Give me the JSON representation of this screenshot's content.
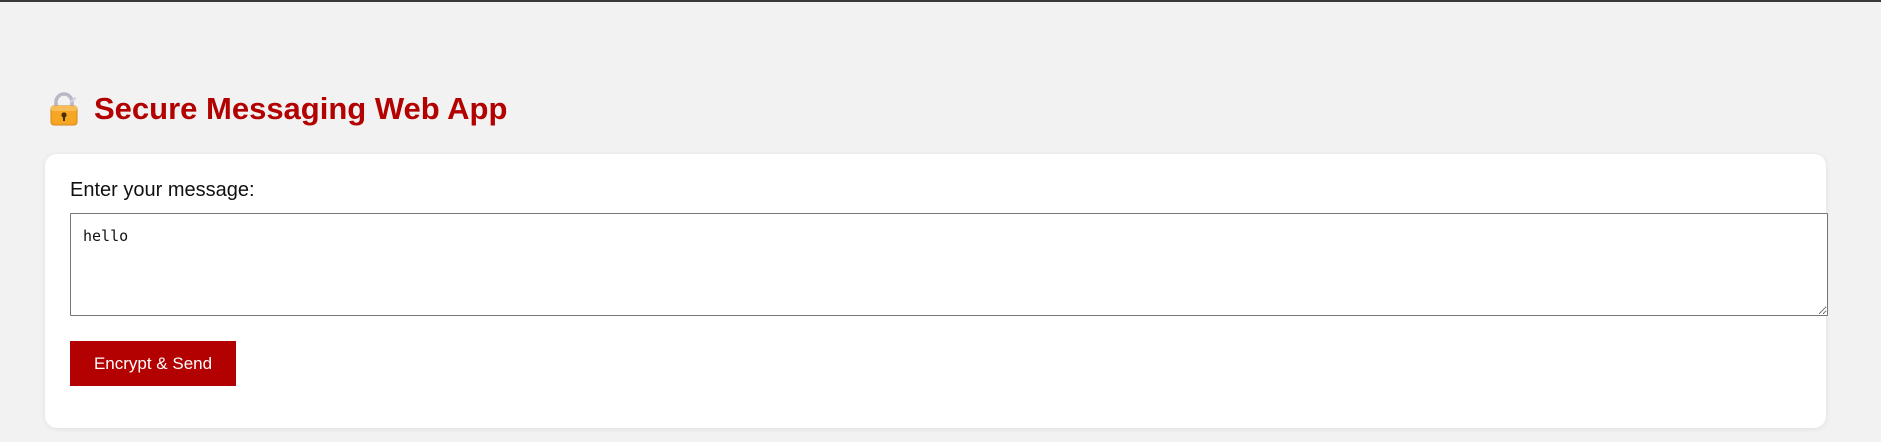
{
  "header": {
    "title": "Secure Messaging Web App",
    "icon": "lock-icon"
  },
  "form": {
    "label": "Enter your message:",
    "message_value": "hello",
    "send_label": "Encrypt & Send"
  },
  "colors": {
    "accent": "#b30000",
    "background": "#f2f2f2",
    "card": "#ffffff"
  }
}
